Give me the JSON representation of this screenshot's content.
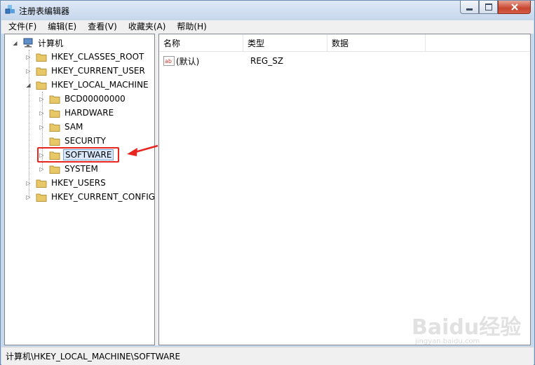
{
  "window": {
    "title": "注册表编辑器"
  },
  "menu": [
    {
      "label": "文件(F)"
    },
    {
      "label": "编辑(E)"
    },
    {
      "label": "查看(V)"
    },
    {
      "label": "收藏夹(A)"
    },
    {
      "label": "帮助(H)"
    }
  ],
  "tree": {
    "root": "计算机",
    "items": [
      {
        "label": "HKEY_CLASSES_ROOT"
      },
      {
        "label": "HKEY_CURRENT_USER"
      },
      {
        "label": "HKEY_LOCAL_MACHINE"
      },
      {
        "label": "BCD00000000"
      },
      {
        "label": "HARDWARE"
      },
      {
        "label": "SAM"
      },
      {
        "label": "SECURITY"
      },
      {
        "label": "SOFTWARE"
      },
      {
        "label": "SYSTEM"
      },
      {
        "label": "HKEY_USERS"
      },
      {
        "label": "HKEY_CURRENT_CONFIG"
      }
    ],
    "selected": "SOFTWARE"
  },
  "list": {
    "columns": [
      "名称",
      "类型",
      "数据"
    ],
    "rows": [
      {
        "name": "(默认)",
        "type": "REG_SZ",
        "data": ""
      }
    ]
  },
  "status": {
    "path": "计算机\\HKEY_LOCAL_MACHINE\\SOFTWARE"
  },
  "watermark": {
    "brand": "Baidu经验",
    "url": "jingyan.baidu.com"
  },
  "colors": {
    "highlight": "#e8261f",
    "folder": "#e8c766",
    "selection": "#d9e8fb"
  }
}
